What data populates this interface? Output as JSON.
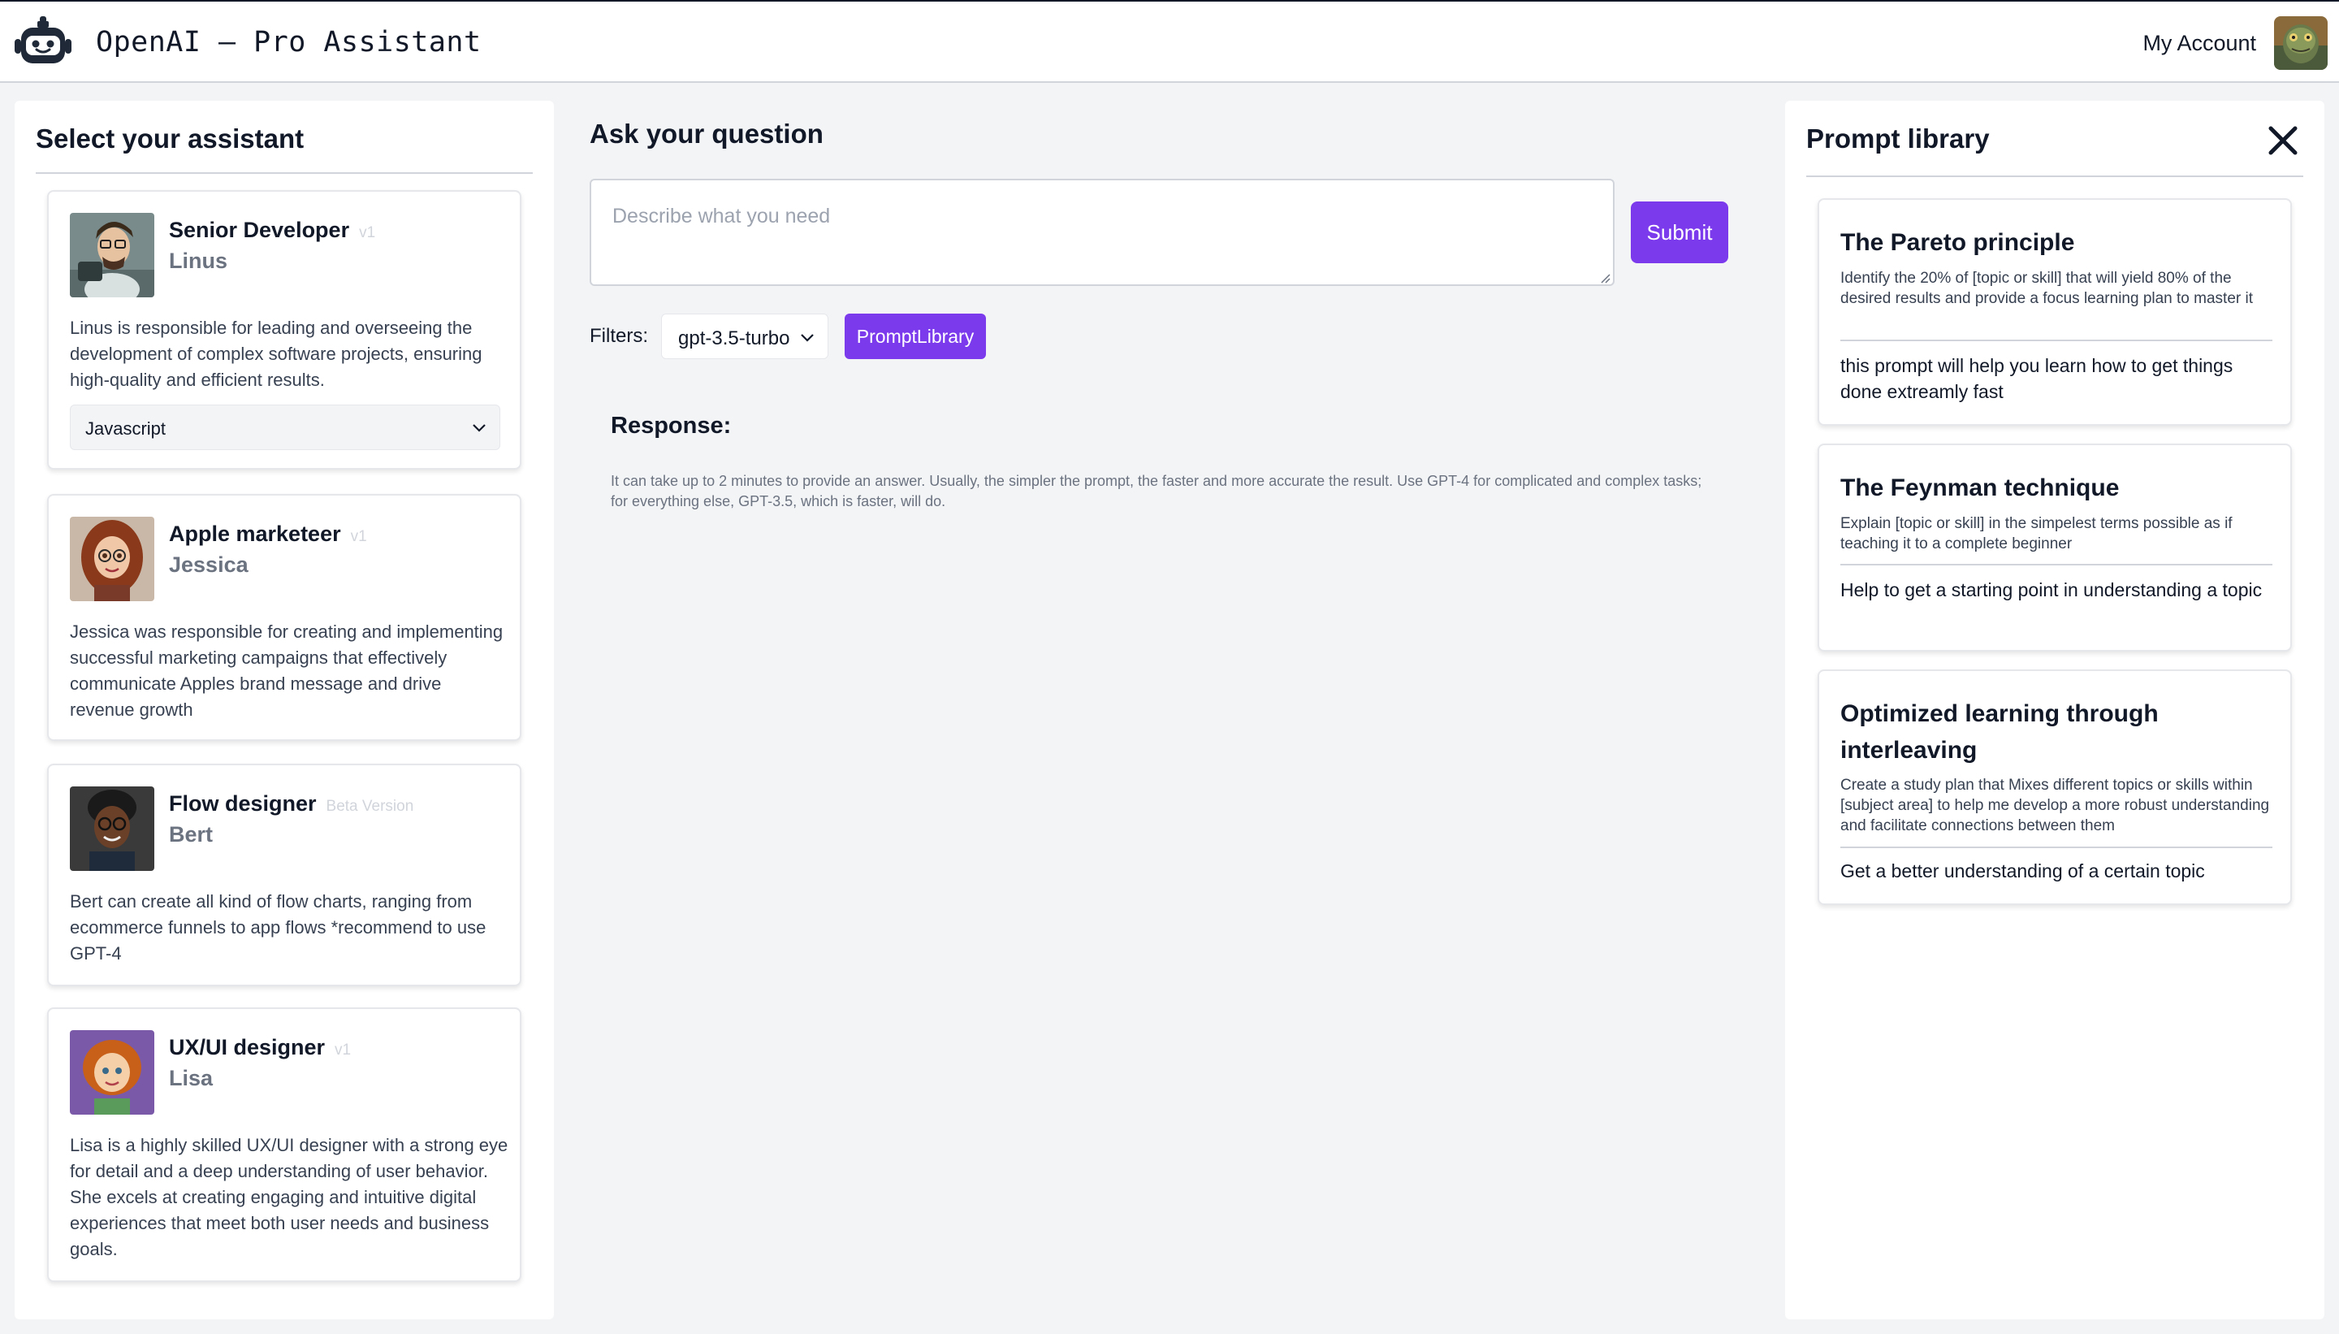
{
  "header": {
    "app_title": "OpenAI – Pro Assistant",
    "account_label": "My Account"
  },
  "left_panel": {
    "title": "Select your assistant",
    "assistants": [
      {
        "role": "Senior Developer",
        "version": "v1",
        "name": "Linus",
        "description": "Linus is responsible for leading and overseeing the development of complex software projects, ensuring high-quality and efficient results.",
        "language_select": "Javascript"
      },
      {
        "role": "Apple marketeer",
        "version": "v1",
        "name": "Jessica",
        "description": "Jessica was responsible for creating and implementing successful marketing campaigns that effectively communicate Apples brand message and drive revenue growth"
      },
      {
        "role": "Flow designer",
        "version": "Beta Version",
        "name": "Bert",
        "description": "Bert can create all kind of flow charts, ranging from ecommerce funnels to app flows *recommend to use GPT-4"
      },
      {
        "role": "UX/UI designer",
        "version": "v1",
        "name": "Lisa",
        "description": "Lisa is a highly skilled UX/UI designer with a strong eye for detail and a deep understanding of user behavior. She excels at creating engaging and intuitive digital experiences that meet both user needs and business goals."
      }
    ]
  },
  "center": {
    "title": "Ask your question",
    "question_placeholder": "Describe what you need",
    "submit_label": "Submit",
    "filters_label": "Filters:",
    "model_select": "gpt-3.5-turbo",
    "prompt_library_button": "PromptLibrary",
    "response_title": "Response:",
    "response_note": "It can take up to 2 minutes to provide an answer. Usually, the simpler the prompt, the faster and more accurate the result. Use GPT-4 for complicated and complex tasks; for everything else, GPT-3.5, which is faster, will do."
  },
  "right_panel": {
    "title": "Prompt library",
    "prompts": [
      {
        "title": "The Pareto principle",
        "prompt": "Identify the 20% of [topic or skill] that will yield 80% of the desired results and provide a focus learning plan to master it",
        "benefit": "this prompt will help you learn how to get things done extreamly fast"
      },
      {
        "title": "The Feynman technique",
        "prompt": "Explain [topic or skill] in the simpelest terms possible as if teaching it to a complete beginner",
        "benefit": "Help to get a starting point in understanding a topic"
      },
      {
        "title": "Optimized learning through interleaving",
        "prompt": "Create a study plan that Mixes different topics or skills within [subject area] to help me develop a more robust understanding and facilitate connections between them",
        "benefit": "Get a better understanding of a certain topic"
      }
    ]
  },
  "colors": {
    "accent": "#7c3aed",
    "background": "#f3f4f6",
    "panel": "#ffffff"
  },
  "icons": {
    "logo": "robot-icon",
    "close": "close-icon",
    "dropdown": "chevron-down-icon"
  }
}
